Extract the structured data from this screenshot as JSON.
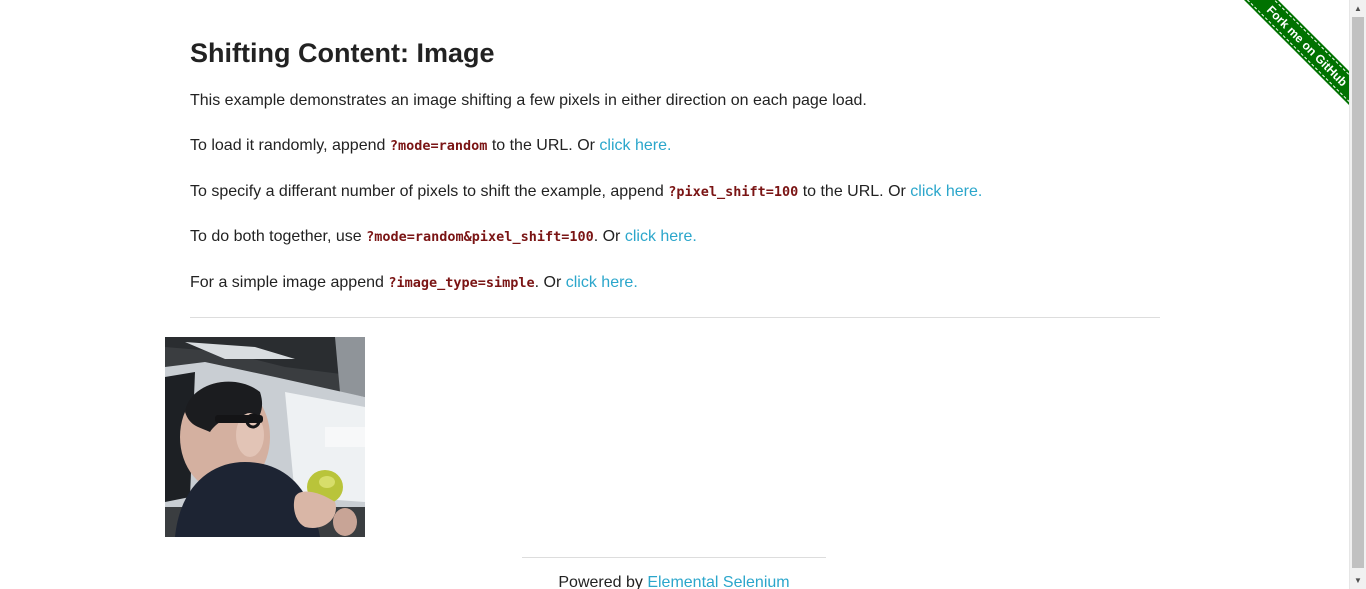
{
  "page": {
    "title": "Shifting Content: Image"
  },
  "paragraphs": {
    "intro": "This example demonstrates an image shifting a few pixels in either direction on each page load.",
    "random_prefix": "To load it randomly, append ",
    "random_code": "?mode=random",
    "random_suffix": " to the URL. Or ",
    "random_link": "click here",
    "shift_prefix": "To specify a differant number of pixels to shift the example, append ",
    "shift_code": "?pixel_shift=100",
    "shift_suffix": " to the URL. Or ",
    "shift_link": "click here",
    "both_prefix": "To do both together, use ",
    "both_code": "?mode=random&pixel_shift=100",
    "both_suffix": ". Or ",
    "both_link": "click here",
    "simple_prefix": "For a simple image append ",
    "simple_code": "?image_type=simple",
    "simple_suffix": ". Or ",
    "simple_link": "click here",
    "period": "."
  },
  "image": {
    "alt": "Person eating an apple in a car"
  },
  "footer": {
    "prefix": "Powered by ",
    "link": "Elemental Selenium"
  },
  "ribbon": {
    "label": "Fork me on GitHub",
    "color": "#007200"
  },
  "colors": {
    "link": "#2ba6cb",
    "code": "#7a1414",
    "text": "#222222"
  },
  "scrollbar": {
    "up_icon": "scroll-up-arrow-icon",
    "down_icon": "scroll-down-arrow-icon"
  }
}
